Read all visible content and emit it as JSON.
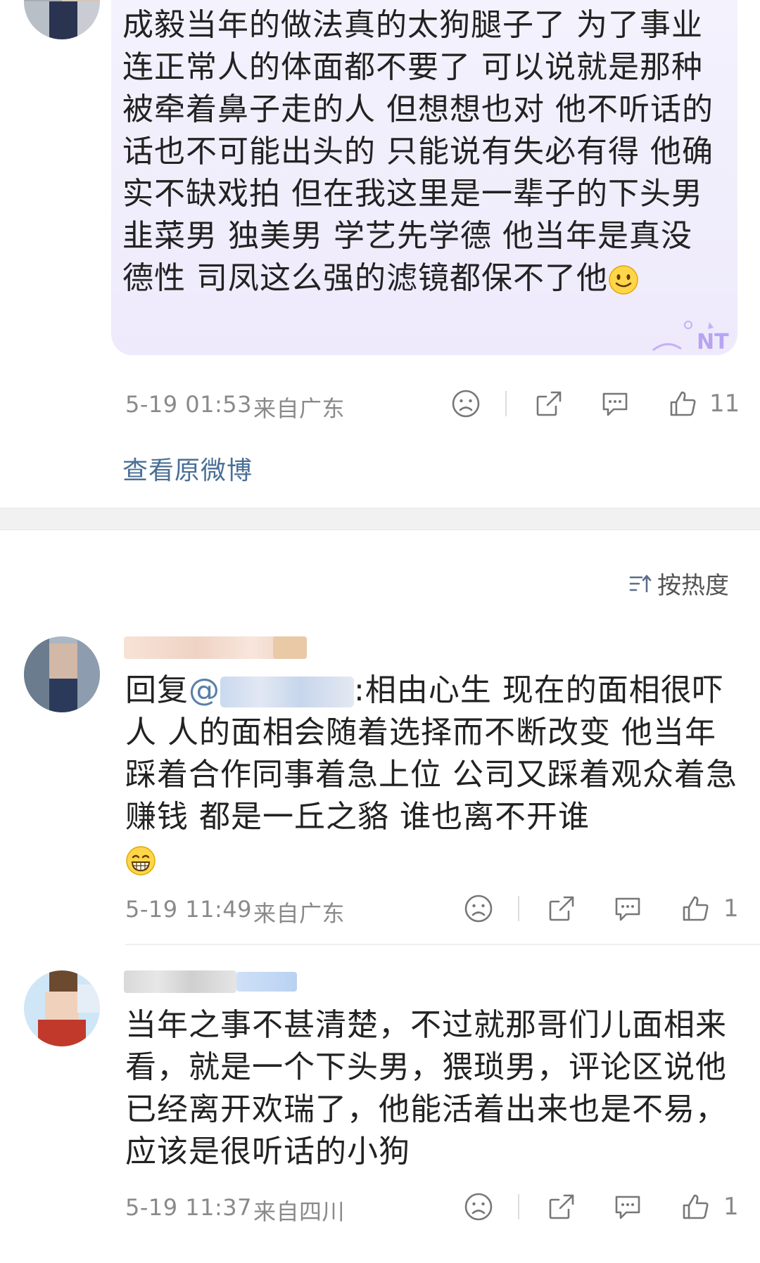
{
  "comment1": {
    "text": "成毅当年的做法真的太狗腿子了 为了事业 连正常人的体面都不要了 可以说就是那种被牵着鼻子走的人 但想想也对 他不听话的话也不可能出头的 只能说有失必有得 他确实不缺戏拍 但在我这里是一辈子的下头男 韭菜男 独美男 学艺先学德 他当年是真没德性 司凤这么强的滤镜都保不了他",
    "emoji": "smile-emoji",
    "time": "5-19 01:53",
    "location": "来自广东",
    "likes": "11",
    "view_original": "查看原微博"
  },
  "sort": {
    "label": "按热度",
    "icon": "sort-icon"
  },
  "comment2": {
    "reply_prefix": "回复",
    "reply_mention_prefix": "@",
    "text_after": ":相由心生 现在的面相很吓人  人的面相会随着选择而不断改变 他当年踩着合作同事着急上位 公司又踩着观众着急赚钱 都是一丘之貉 谁也离不开谁",
    "emoji": "grin-emoji",
    "time": "5-19 11:49",
    "location": "来自广东",
    "likes": "1"
  },
  "comment3": {
    "text": "当年之事不甚清楚，不过就那哥们儿面相来看，就是一个下头男，猥琐男，评论区说他已经离开欢瑞了，他能活着出来也是不易，应该是很听话的小狗",
    "time": "5-19 11:37",
    "location": "来自四川",
    "likes": "1"
  },
  "colors": {
    "link": "#4a6f96",
    "meta": "#8a8a8a",
    "bubble": "#f0edfc"
  }
}
